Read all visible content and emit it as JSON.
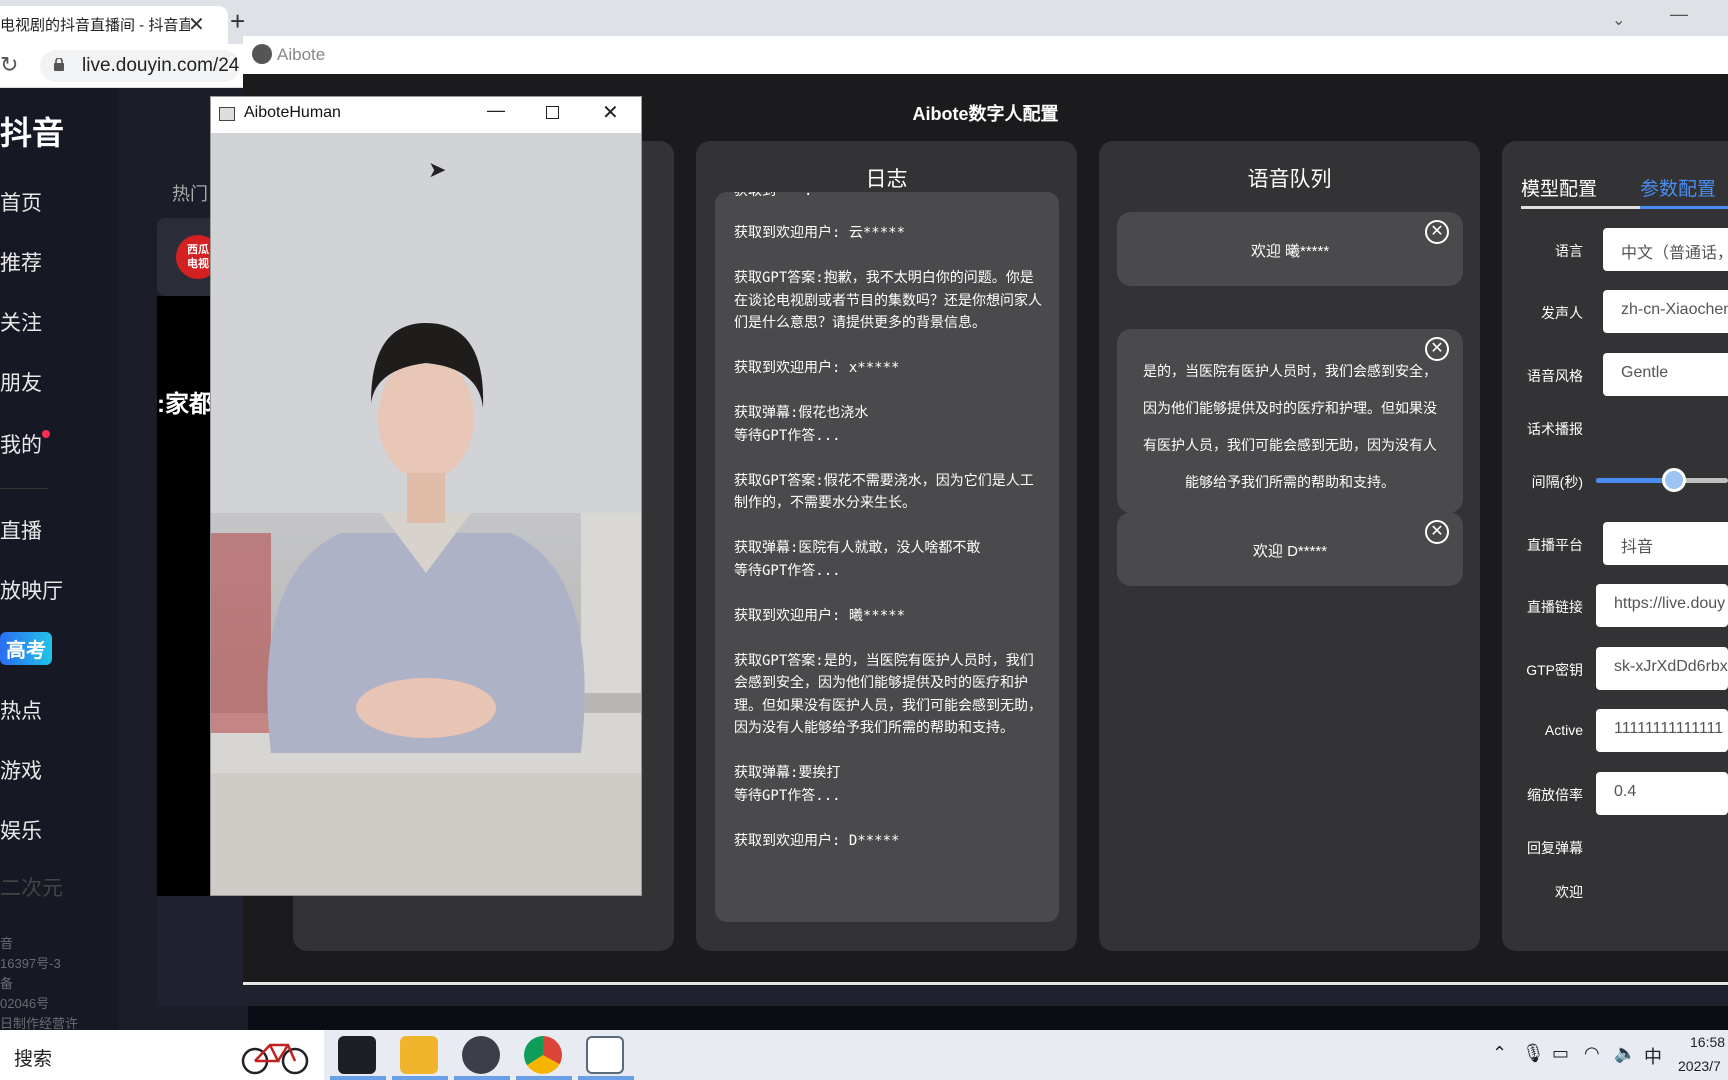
{
  "browser": {
    "tab_title": "电视剧的抖音直播间 - 抖音直",
    "url": "live.douyin.com/24"
  },
  "douyin": {
    "logo": "抖音",
    "nav": [
      "首页",
      "推荐",
      "关注",
      "朋友",
      "我的",
      "直播",
      "放映厅",
      "高考",
      "热点",
      "游戏",
      "娱乐",
      "二次元"
    ],
    "hot_label": "热门",
    "card_avatar_text": "西瓜\n电视",
    "video_caption": ":家都",
    "footer": [
      "音",
      "16397号-3",
      "备",
      "02046号",
      "日制作经营许"
    ]
  },
  "aibote": {
    "window_title": "Aibote",
    "header": "Aibote数字人配置",
    "log": {
      "title": "日志",
      "partial_top": "获取到　　:",
      "content": "获取到欢迎用户: 云*****\n\n获取GPT答案:抱歉，我不太明白你的问题。你是在谈论电视剧或者节目的集数吗？还是你想问家人们是什么意思？请提供更多的背景信息。\n\n获取到欢迎用户: x*****\n\n获取弹幕:假花也浇水\n等待GPT作答...\n\n获取GPT答案:假花不需要浇水，因为它们是人工制作的，不需要水分来生长。\n\n获取弹幕:医院有人就敢，没人啥都不敢\n等待GPT作答...\n\n获取到欢迎用户: 曦*****\n\n获取GPT答案:是的，当医院有医护人员时，我们会感到安全，因为他们能够提供及时的医疗和护理。但如果没有医护人员，我们可能会感到无助，因为没有人能够给予我们所需的帮助和支持。\n\n获取弹幕:要挨打\n等待GPT作答...\n\n获取到欢迎用户: D*****"
    },
    "queue": {
      "title": "语音队列",
      "items": [
        "欢迎 曦*****",
        "是的，当医院有医护人员时，我们会感到安全，因为他们能够提供及时的医疗和护理。但如果没有医护人员，我们可能会感到无助，因为没有人能够给予我们所需的帮助和支持。",
        "欢迎 D*****"
      ]
    },
    "config": {
      "tabs": [
        "模型配置",
        "参数配置"
      ],
      "active_tab": "参数配置",
      "fields": {
        "language": {
          "label": "语言",
          "value": "中文（普通话，"
        },
        "speaker": {
          "label": "发声人",
          "value": "zh-cn-Xiaochen"
        },
        "style": {
          "label": "语音风格",
          "value": "Gentle"
        },
        "script_broadcast": {
          "label": "话术播报"
        },
        "interval": {
          "label": "间隔(秒)",
          "slider_fraction": 0.6
        },
        "platform": {
          "label": "直播平台",
          "value": "抖音"
        },
        "live_url": {
          "label": "直播链接",
          "value": "https://live.douy"
        },
        "gpt_key": {
          "label": "GTP密钥",
          "value": "sk-xJrXdDd6rbx"
        },
        "active": {
          "label": "Active",
          "value": "11111111111111"
        },
        "zoom": {
          "label": "缩放倍率",
          "value": "0.4"
        },
        "reply_danmu": {
          "label": "回复弹幕"
        },
        "welcome": {
          "label": "欢迎"
        }
      }
    }
  },
  "human_window": {
    "title": "AiboteHuman"
  },
  "taskbar": {
    "search": "搜索",
    "ime": "中",
    "time": "16:58",
    "date": "2023/7"
  },
  "colors": {
    "accent": "#4a8df0",
    "panel": "#333335",
    "panel_inner": "#4a4a4c"
  }
}
